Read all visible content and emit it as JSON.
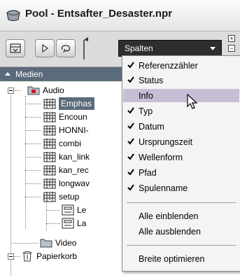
{
  "window": {
    "title": "Pool - Entsafter_Desaster.npr",
    "view_select": "Spalten"
  },
  "column_header": {
    "label": "Medien"
  },
  "tree": {
    "audio": "Audio",
    "items": [
      "Emphas",
      "Encoun",
      "HONNI-",
      "combi",
      "kan_link",
      "kan_rec",
      "longwav",
      "setup",
      "Le",
      "La"
    ],
    "video": "Video",
    "trash": "Papierkorb"
  },
  "menu": {
    "items": [
      {
        "label": "Referenzzähler",
        "checked": true
      },
      {
        "label": "Status",
        "checked": true
      },
      {
        "label": "Info",
        "checked": false,
        "highlighted": true
      },
      {
        "label": "Typ",
        "checked": true
      },
      {
        "label": "Datum",
        "checked": true
      },
      {
        "label": "Ursprungszeit",
        "checked": true
      },
      {
        "label": "Wellenform",
        "checked": true
      },
      {
        "label": "Pfad",
        "checked": true
      },
      {
        "label": "Spulenname",
        "checked": true
      }
    ],
    "show_all": "Alle einblenden",
    "hide_all": "Alle ausblenden",
    "optimize_width": "Breite optimieren"
  },
  "colors": {
    "header_bg": "#5b6b7b",
    "menu_highlight": "#c7bdd4",
    "selection": "#5b6b7b",
    "select_bg": "#2e2e2e"
  }
}
